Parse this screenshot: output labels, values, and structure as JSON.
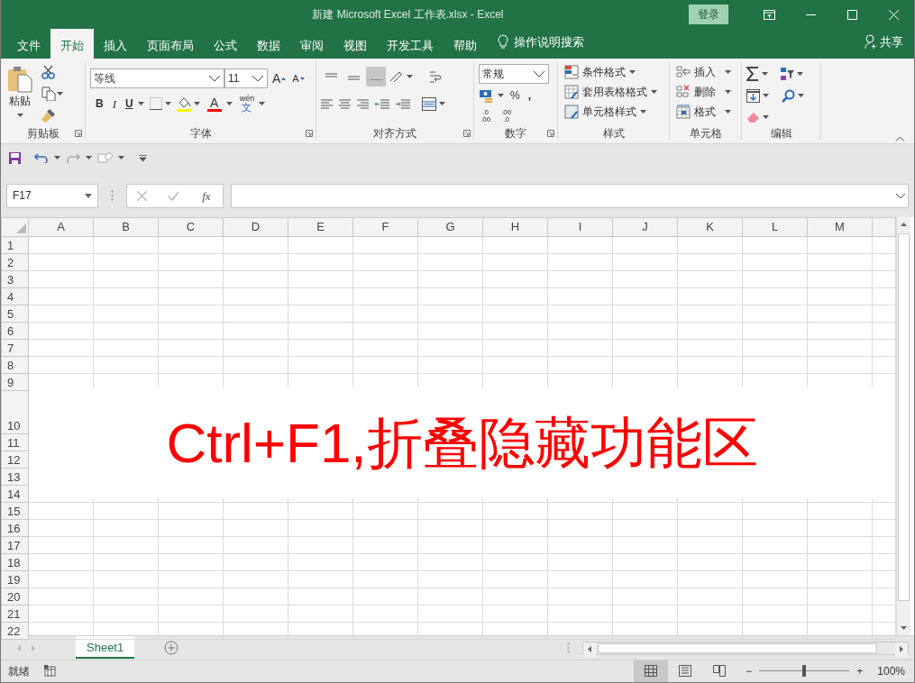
{
  "window": {
    "title": "新建 Microsoft Excel 工作表.xlsx  -  Excel",
    "sign_in": "登录"
  },
  "ribbon_tabs": [
    {
      "label": "文件",
      "selected": false
    },
    {
      "label": "开始",
      "selected": true
    },
    {
      "label": "插入",
      "selected": false
    },
    {
      "label": "页面布局",
      "selected": false
    },
    {
      "label": "公式",
      "selected": false
    },
    {
      "label": "数据",
      "selected": false
    },
    {
      "label": "审阅",
      "selected": false
    },
    {
      "label": "视图",
      "selected": false
    },
    {
      "label": "开发工具",
      "selected": false
    },
    {
      "label": "帮助",
      "selected": false
    }
  ],
  "tell_me": "操作说明搜索",
  "share": "共享",
  "clipboard": {
    "label": "剪贴板",
    "paste": "粘贴"
  },
  "font": {
    "label": "字体",
    "font_name": "等线",
    "font_size": "11",
    "grow": "A",
    "shrink": "A",
    "bold": "B",
    "italic": "I",
    "underline": "U",
    "font_color": "A",
    "phonetic_top": "wén",
    "phonetic_bottom": "文"
  },
  "alignment": {
    "label": "对齐方式",
    "vertical": [
      {
        "selected": false
      },
      {
        "selected": false
      },
      {
        "selected": true
      }
    ]
  },
  "number": {
    "label": "数字",
    "format": "常规",
    "percent": "%",
    "comma": ",",
    "decimals": [
      {
        "top": ".0",
        "bottom": ".00"
      },
      {
        "top": ".00",
        "bottom": ".0"
      }
    ]
  },
  "styles": {
    "label": "样式",
    "items": [
      "条件格式",
      "套用表格格式",
      "单元格样式"
    ]
  },
  "cells": {
    "label": "单元格",
    "items": [
      "插入",
      "删除",
      "格式"
    ]
  },
  "editing": {
    "label": "编辑"
  },
  "name_box": "F17",
  "insert_function": "fx",
  "columns": [
    "A",
    "B",
    "C",
    "D",
    "E",
    "F",
    "G",
    "H",
    "I",
    "J",
    "K",
    "L",
    "M"
  ],
  "rows": [
    "1",
    "2",
    "3",
    "4",
    "5",
    "6",
    "7",
    "8",
    "9",
    "10",
    "11",
    "12",
    "13",
    "14",
    "15",
    "16",
    "17",
    "18",
    "19",
    "20",
    "21",
    "22"
  ],
  "text_box": "Ctrl+F1,折叠隐藏功能区",
  "sheets": [
    {
      "label": "Sheet1",
      "selected": true
    }
  ],
  "status": "就绪",
  "views": [
    {
      "kind": "normal",
      "selected": true
    },
    {
      "kind": "layout",
      "selected": false
    },
    {
      "kind": "pagebreak",
      "selected": false
    }
  ],
  "zoom": {
    "minus": "−",
    "plus": "+",
    "level": 0.5,
    "text": "100%"
  }
}
